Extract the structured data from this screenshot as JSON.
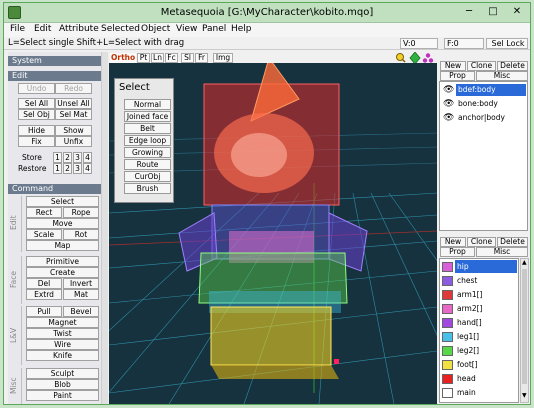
{
  "window": {
    "title": "Metasequoia [G:\\MyCharacter\\kobito.mqo]",
    "min": "─",
    "max": "□",
    "close": "✕"
  },
  "menu": [
    "File",
    "Edit",
    "Attribute",
    "Selected",
    "Object",
    "View",
    "Panel",
    "Help"
  ],
  "status": {
    "hint": "L=Select single  Shift+L=Select with drag",
    "v_label": "V:0",
    "f_label": "F:0",
    "sel_lock": "Sel Lock"
  },
  "left": {
    "system_head": "System",
    "edit_head": "Edit",
    "undo": "Undo",
    "redo": "Redo",
    "sel_all": "Sel All",
    "unsel_all": "Unsel All",
    "sel_obj": "Sel Obj",
    "sel_mat": "Sel Mat",
    "hide": "Hide",
    "show": "Show",
    "fix": "Fix",
    "unfix": "Unfix",
    "store": "Store",
    "restore": "Restore",
    "slots": [
      "1",
      "2",
      "3",
      "4"
    ],
    "command_head": "Command",
    "edit_group": "Edit",
    "select": "Select",
    "rect": "Rect",
    "rope": "Rope",
    "move": "Move",
    "scale": "Scale",
    "rot": "Rot",
    "map": "Map",
    "face_group": "Face",
    "primitive": "Primitive",
    "create": "Create",
    "del": "Del",
    "invert": "Invert",
    "extrd": "Extrd",
    "mat": "Mat",
    "lv_group": "L&V",
    "pull": "Pull",
    "bevel": "Bevel",
    "magnet": "Magnet",
    "twist": "Twist",
    "wire": "Wire",
    "knife": "Knife",
    "misc_group": "Misc",
    "sculpt": "Sculpt",
    "blob": "Blob",
    "paint": "Paint"
  },
  "viewport": {
    "tabs": [
      "Ortho",
      "Pt",
      "Ln",
      "Fc",
      "Sl",
      "Fr",
      "Img"
    ],
    "select_panel": {
      "title": "Select",
      "items": [
        "Normal",
        "Joined face",
        "Belt",
        "Edge loop",
        "Growing",
        "Route",
        "CurObj",
        "Brush"
      ]
    }
  },
  "right": {
    "new": "New",
    "clone": "Clone",
    "delete": "Delete",
    "prop": "Prop",
    "misc": "Misc",
    "objects": [
      {
        "name": "bdef:body",
        "selected": true
      },
      {
        "name": "bone:body",
        "selected": false
      },
      {
        "name": "anchor|body",
        "selected": false
      }
    ],
    "materials": [
      {
        "name": "hip",
        "color": "#d860d8",
        "selected": true
      },
      {
        "name": "chest",
        "color": "#8c5ce0"
      },
      {
        "name": "arm1[]",
        "color": "#e03838"
      },
      {
        "name": "arm2[]",
        "color": "#e868c8"
      },
      {
        "name": "hand[]",
        "color": "#a048e0"
      },
      {
        "name": "leg1[]",
        "color": "#48c0e8"
      },
      {
        "name": "leg2[]",
        "color": "#58d848"
      },
      {
        "name": "foot[]",
        "color": "#f0e040"
      },
      {
        "name": "head",
        "color": "#e82020"
      },
      {
        "name": "main",
        "color": "#ffffff"
      }
    ]
  },
  "colors": {
    "accent": "#2a6ad8",
    "viewport_bg": "#16323e",
    "section_head": "#6c7a8e"
  }
}
